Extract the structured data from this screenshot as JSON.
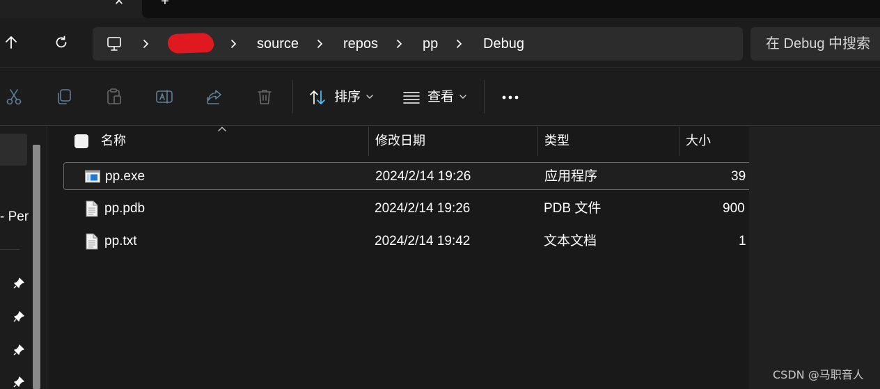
{
  "tabs": {
    "close_glyph": "✕",
    "new_tab_glyph": "+"
  },
  "breadcrumb": {
    "root_icon": "this-pc-icon",
    "segments": [
      "source",
      "repos",
      "pp",
      "Debug"
    ]
  },
  "search": {
    "placeholder": "在 Debug 中搜索"
  },
  "toolbar": {
    "sort_label": "排序",
    "view_label": "查看",
    "more_glyph": "•••"
  },
  "nav": {
    "partial_label": "- Per"
  },
  "columns": {
    "name": "名称",
    "modified": "修改日期",
    "type": "类型",
    "size": "大小"
  },
  "files": [
    {
      "name": "pp.exe",
      "modified": "2024/2/14 19:26",
      "type": "应用程序",
      "size": "39",
      "icon": "exe-icon"
    },
    {
      "name": "pp.pdb",
      "modified": "2024/2/14 19:26",
      "type": "PDB 文件",
      "size": "900",
      "icon": "document-icon"
    },
    {
      "name": "pp.txt",
      "modified": "2024/2/14 19:42",
      "type": "文本文档",
      "size": "1",
      "icon": "document-icon"
    }
  ],
  "watermark": "CSDN @马职音人",
  "colors": {
    "background": "#191919",
    "panel": "#1c1c1c",
    "field": "#2c2c2c",
    "redaction": "#e0181f",
    "exe_accent": "#1e78d7"
  }
}
